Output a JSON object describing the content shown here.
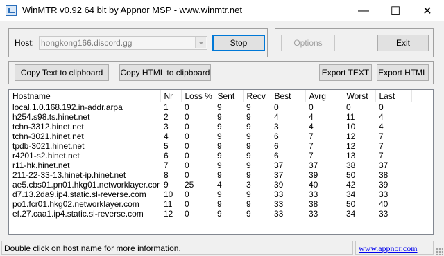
{
  "window": {
    "title": "WinMTR v0.92 64 bit by Appnor MSP - www.winmtr.net",
    "minimize_glyph": "—",
    "maximize_glyph": "☐",
    "close_glyph": "✕"
  },
  "controls": {
    "host_label": "Host:",
    "host_value": "hongkong166.discord.gg",
    "stop_label": "Stop",
    "options_label": "Options",
    "exit_label": "Exit",
    "copy_text_label": "Copy Text to clipboard",
    "copy_html_label": "Copy HTML to clipboard",
    "export_text_label": "Export TEXT",
    "export_html_label": "Export HTML"
  },
  "table": {
    "columns": [
      "Hostname",
      "Nr",
      "Loss %",
      "Sent",
      "Recv",
      "Best",
      "Avrg",
      "Worst",
      "Last"
    ],
    "rows": [
      [
        "local.1.0.168.192.in-addr.arpa",
        "1",
        "0",
        "9",
        "9",
        "0",
        "0",
        "0",
        "0"
      ],
      [
        "h254.s98.ts.hinet.net",
        "2",
        "0",
        "9",
        "9",
        "4",
        "4",
        "11",
        "4"
      ],
      [
        "tchn-3312.hinet.net",
        "3",
        "0",
        "9",
        "9",
        "3",
        "4",
        "10",
        "4"
      ],
      [
        "tchn-3021.hinet.net",
        "4",
        "0",
        "9",
        "9",
        "6",
        "7",
        "12",
        "7"
      ],
      [
        "tpdb-3021.hinet.net",
        "5",
        "0",
        "9",
        "9",
        "6",
        "7",
        "12",
        "7"
      ],
      [
        "r4201-s2.hinet.net",
        "6",
        "0",
        "9",
        "9",
        "6",
        "7",
        "13",
        "7"
      ],
      [
        "r11-hk.hinet.net",
        "7",
        "0",
        "9",
        "9",
        "37",
        "37",
        "38",
        "37"
      ],
      [
        "211-22-33-13.hinet-ip.hinet.net",
        "8",
        "0",
        "9",
        "9",
        "37",
        "39",
        "50",
        "38"
      ],
      [
        "ae5.cbs01.pn01.hkg01.networklayer.com",
        "9",
        "25",
        "4",
        "3",
        "39",
        "40",
        "42",
        "39"
      ],
      [
        "d7.13.2da9.ip4.static.sl-reverse.com",
        "10",
        "0",
        "9",
        "9",
        "33",
        "33",
        "34",
        "33"
      ],
      [
        "po1.fcr01.hkg02.networklayer.com",
        "11",
        "0",
        "9",
        "9",
        "33",
        "38",
        "50",
        "40"
      ],
      [
        "ef.27.caa1.ip4.static.sl-reverse.com",
        "12",
        "0",
        "9",
        "9",
        "33",
        "33",
        "34",
        "33"
      ]
    ]
  },
  "status": {
    "message": "Double click on host name for more information.",
    "link": "www.appnor.com"
  }
}
